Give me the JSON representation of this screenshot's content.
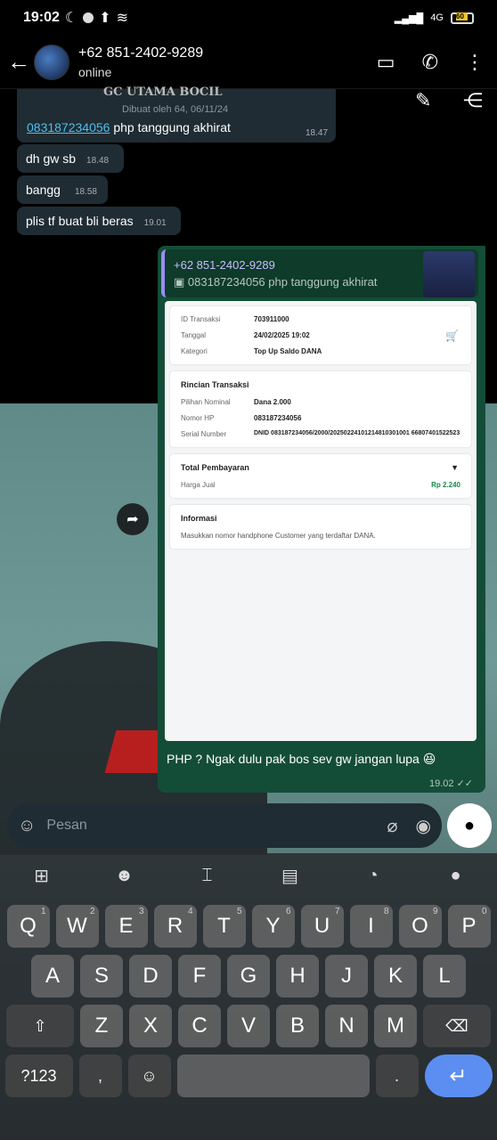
{
  "status": {
    "time": "19:02",
    "network": "4G",
    "battery": "60"
  },
  "header": {
    "name": "+62 851-2402-9289",
    "status": "online"
  },
  "top_bubble": {
    "title": "GC UTAMA BOCIL",
    "sub": "Dibuat oleh 64, 06/11/24",
    "link": "083187234056",
    "text": " php tanggung akhirat",
    "time": "18.47"
  },
  "messages": [
    {
      "text": "dh gw sb",
      "time": "18.48"
    },
    {
      "text": "bangg",
      "time": "18.58"
    },
    {
      "text": "plis tf buat bli beras",
      "time": "19.01"
    }
  ],
  "reply": {
    "name": "+62 851-2402-9289",
    "quote": "083187234056 php tanggung akhirat"
  },
  "receipt": {
    "detail": [
      {
        "label": "ID Transaksi",
        "value": "703911000"
      },
      {
        "label": "Tanggal",
        "value": "24/02/2025 19:02"
      },
      {
        "label": "Kategori",
        "value": "Top Up Saldo DANA"
      }
    ],
    "rincian_title": "Rincian Transaksi",
    "rincian": [
      {
        "label": "Pilihan Nominal",
        "value": "Dana 2.000"
      },
      {
        "label": "Nomor HP",
        "value": "083187234056"
      },
      {
        "label": "Serial Number",
        "value": "DNID 083187234056/2000/20250224101214810301001 66807401522523"
      }
    ],
    "total_title": "Total Pembayaran",
    "harga_label": "Harga Jual",
    "harga_value": "Rp 2.240",
    "info_title": "Informasi",
    "info_text": "Masukkan nomor handphone Customer yang terdaftar DANA."
  },
  "caption": "PHP ? Ngak dulu pak bos sev gw jangan lupa 😆",
  "caption_time": "19.02",
  "input_placeholder": "Pesan",
  "keyboard": {
    "row1": [
      "Q",
      "W",
      "E",
      "R",
      "T",
      "Y",
      "U",
      "I",
      "O",
      "P"
    ],
    "row1_sup": [
      "1",
      "2",
      "3",
      "4",
      "5",
      "6",
      "7",
      "8",
      "9",
      "0"
    ],
    "row2": [
      "A",
      "S",
      "D",
      "F",
      "G",
      "H",
      "J",
      "K",
      "L"
    ],
    "row3": [
      "Z",
      "X",
      "C",
      "V",
      "B",
      "N",
      "M"
    ],
    "sym": "?123",
    "comma": ",",
    "period": "."
  }
}
